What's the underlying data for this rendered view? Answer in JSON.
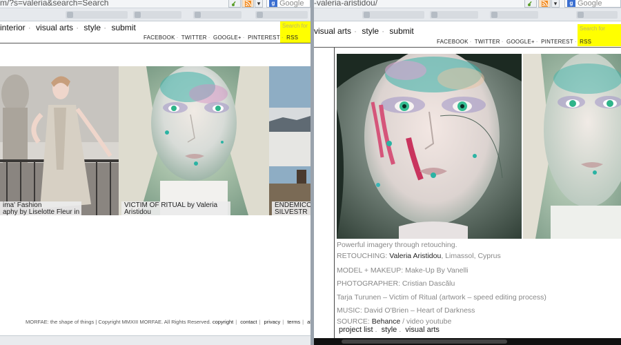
{
  "left": {
    "url": "m/?s=valeria&search=Search",
    "nav": [
      "interior",
      "visual arts",
      "style",
      "submit"
    ],
    "social": [
      "FACEBOOK",
      "TWITTER",
      "GOOGLE+",
      "PINTEREST",
      "RSS"
    ],
    "search_placeholder": "Search for",
    "browser_search": "Google",
    "tiles": [
      {
        "caption_line1": "ima' Fashion",
        "caption_line2": "aphy by Liselotte Fleur in"
      },
      {
        "caption_line1": "VICTIM OF RITUAL by Valeria",
        "caption_line2": "Aristidou"
      },
      {
        "caption_line1": "ENDEMICO",
        "caption_line2": "SILVESTR"
      }
    ],
    "footer": {
      "text": "MORFAE: the shape of things | Copyright MMXIII MORFAE. All Rights Reserved.",
      "links": [
        "copyright",
        "contact",
        "privacy",
        "terms",
        "about"
      ]
    }
  },
  "right": {
    "url": "-valeria-aristidou/",
    "nav": [
      "visual arts",
      "style",
      "submit"
    ],
    "social": [
      "FACEBOOK",
      "TWITTER",
      "GOOGLE+",
      "PINTEREST",
      "RSS"
    ],
    "search_placeholder": "Search for",
    "browser_search": "Google",
    "credits": {
      "intro": "Powerful imagery through retouching.",
      "retouching_label": "RETOUCHING: ",
      "retouching_name": "Valeria Aristidou",
      "retouching_place": ", Limassol, Cyprus",
      "model": "MODEL + MAKEUP: Make-Up By Vanelli",
      "photographer": "PHOTOGRAPHER: Cristian Dascălu",
      "video": "Tarja Turunen – Victim of Ritual (artwork – speed editing process)",
      "music": "MUSIC: David O'Brien – Heart of Darkness",
      "source_label": "SOURCE: ",
      "source_link": "Behance",
      "source_rest": " / video youtube"
    },
    "tags": [
      "project list",
      "style",
      "visual arts"
    ]
  },
  "colors": {
    "search_yellow": "#ffff00",
    "divider": "#9aa3ad",
    "teal_paint": "#2bb3a3",
    "pink_paint": "#d5557a",
    "skin": "#e8d6cf"
  },
  "icons": [
    "key-icon",
    "rss-icon",
    "dropdown-arrow-icon",
    "google-icon"
  ]
}
